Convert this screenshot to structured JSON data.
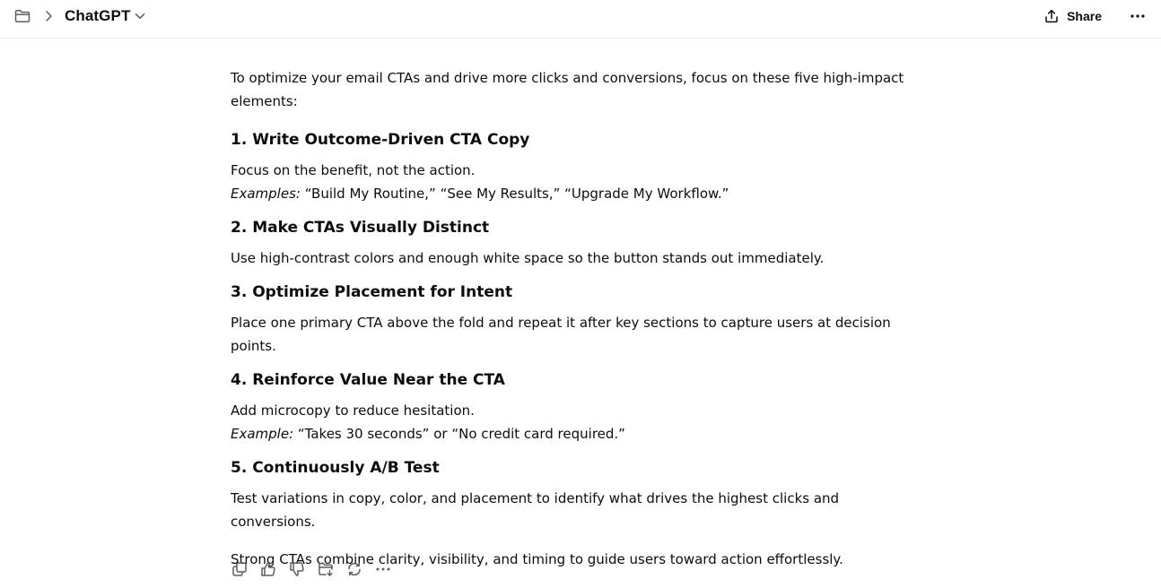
{
  "header": {
    "title": "ChatGPT",
    "share_label": "Share",
    "icons": [
      "folder-icon",
      "chevron-right-icon",
      "chevron-down-icon",
      "share-icon",
      "more-icon"
    ]
  },
  "message": {
    "intro": "To optimize your email CTAs and drive more clicks and conversions, focus on these five high-impact elements:",
    "sections": [
      {
        "heading": "1. Write Outcome-Driven CTA Copy",
        "body": "Focus on the benefit, not the action.",
        "example_label": "Examples:",
        "example_text": " “Build My Routine,” “See My Results,” “Upgrade My Workflow.”"
      },
      {
        "heading": "2. Make CTAs Visually Distinct",
        "body": "Use high-contrast colors and enough white space so the button stands out immediately."
      },
      {
        "heading": "3. Optimize Placement for Intent",
        "body": "Place one primary CTA above the fold and repeat it after key sections to capture users at decision points."
      },
      {
        "heading": "4. Reinforce Value Near the CTA",
        "body": "Add microcopy to reduce hesitation.",
        "example_label": "Example:",
        "example_text": " “Takes 30 seconds” or “No credit card required.”"
      },
      {
        "heading": "5. Continuously A/B Test",
        "body": "Test variations in copy, color, and placement to identify what drives the highest clicks and conversions."
      }
    ],
    "closing": "Strong CTAs combine clarity, visibility, and timing to guide users toward action effortlessly."
  },
  "actions": [
    "copy-icon",
    "thumbs-up-icon",
    "thumbs-down-icon",
    "save-to-folder-icon",
    "regenerate-icon",
    "more-icon"
  ],
  "colors": {
    "text": "#0d0d0d",
    "icon": "#5d5d5d",
    "border": "#ececec",
    "background": "#ffffff"
  }
}
